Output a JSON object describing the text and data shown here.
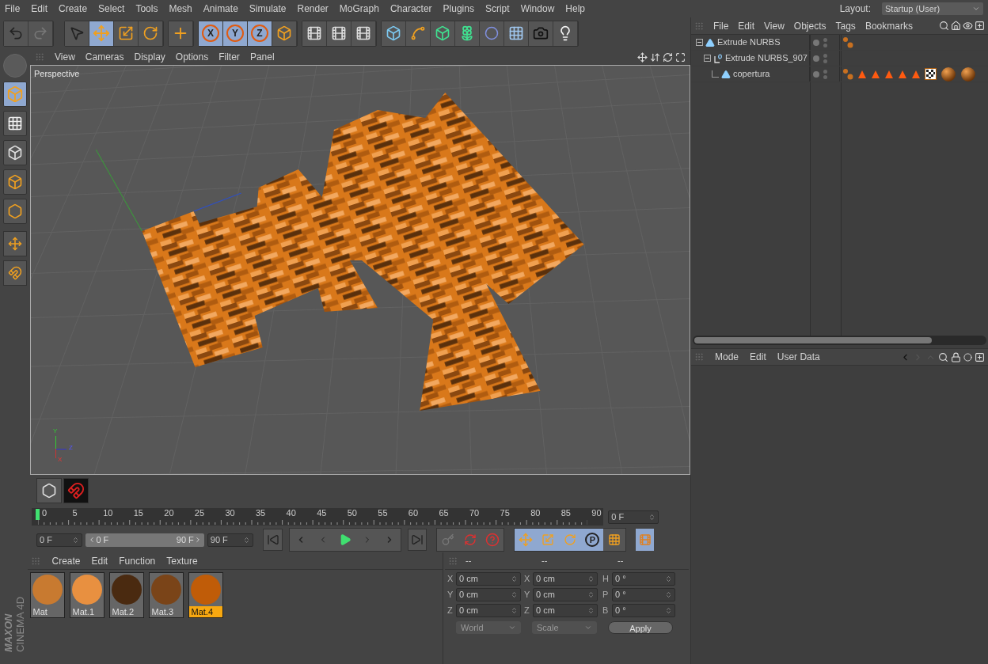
{
  "menu_bar": {
    "items": [
      "File",
      "Edit",
      "Create",
      "Select",
      "Tools",
      "Mesh",
      "Animate",
      "Simulate",
      "Render",
      "MoGraph",
      "Character",
      "Plugins",
      "Script",
      "Window",
      "Help"
    ],
    "layout_label": "Layout:",
    "layout_value": "Startup (User)"
  },
  "toolbar": {
    "tools": [
      {
        "kind": "select",
        "selected": false
      },
      {
        "kind": "move",
        "selected": true
      },
      {
        "kind": "scale",
        "selected": false
      },
      {
        "kind": "rotate",
        "selected": false
      },
      {
        "kind": "add",
        "selected": false
      }
    ],
    "axes": [
      {
        "label": "X",
        "selected": true
      },
      {
        "label": "Y",
        "selected": true
      },
      {
        "label": "Z",
        "selected": true
      }
    ]
  },
  "modes": [
    {
      "kind": "model",
      "selected": true
    },
    {
      "kind": "texture",
      "selected": false
    },
    {
      "kind": "points",
      "selected": false
    },
    {
      "kind": "edges",
      "selected": false
    },
    {
      "kind": "polygons",
      "selected": false
    }
  ],
  "viewport": {
    "menu": [
      "View",
      "Cameras",
      "Display",
      "Options",
      "Filter",
      "Panel"
    ],
    "camera": "Perspective",
    "gizmo_labels": [
      "Y",
      "Z",
      "X"
    ]
  },
  "objects": {
    "menu": [
      "File",
      "Edit",
      "View",
      "Objects",
      "Tags",
      "Bookmarks"
    ],
    "tree": [
      {
        "name": "Extrude NURBS",
        "kind": "extrude",
        "expanded": true,
        "tags": [
          {
            "kind": "phong"
          }
        ],
        "children": [
          {
            "name": "Extrude NURBS_907",
            "kind": "null",
            "expanded": true,
            "children": [
              {
                "name": "copertura",
                "kind": "polygon",
                "tags": [
                  {
                    "kind": "phong"
                  },
                  {
                    "kind": "selection"
                  },
                  {
                    "kind": "selection"
                  },
                  {
                    "kind": "selection"
                  },
                  {
                    "kind": "selection"
                  },
                  {
                    "kind": "selection"
                  },
                  {
                    "kind": "uvw"
                  },
                  {
                    "kind": "material"
                  },
                  {
                    "kind": "material"
                  }
                ]
              }
            ]
          }
        ]
      }
    ]
  },
  "attributes": {
    "menu": [
      "Mode",
      "Edit",
      "User Data"
    ]
  },
  "timeline": {
    "frames": [
      "0",
      "5",
      "10",
      "15",
      "20",
      "25",
      "30",
      "35",
      "40",
      "45",
      "50",
      "55",
      "60",
      "65",
      "70",
      "75",
      "80",
      "85",
      "90"
    ],
    "current": "0 F",
    "playhead": {
      "level": 0
    },
    "start": "0 F",
    "range_start": "0 F",
    "range_end": "90 F",
    "range_slider": {
      "level": 1
    },
    "end": "90 F",
    "key_tracks": [
      {
        "kind": "position",
        "selected": true
      },
      {
        "kind": "scale",
        "selected": true
      },
      {
        "kind": "rotation",
        "selected": true
      },
      {
        "kind": "parameter",
        "label": "P",
        "selected": true
      },
      {
        "kind": "pla",
        "selected": false
      }
    ]
  },
  "materials": {
    "menu": [
      "Create",
      "Edit",
      "Function",
      "Texture"
    ],
    "items": [
      {
        "name": "Mat",
        "color": "#c87a30",
        "selected": false
      },
      {
        "name": "Mat.1",
        "color": "#e89040",
        "selected": false
      },
      {
        "name": "Mat.2",
        "color": "#4a2a10",
        "selected": false
      },
      {
        "name": "Mat.3",
        "color": "#7a4418",
        "selected": false
      },
      {
        "name": "Mat.4",
        "color": "#c05c08",
        "selected": true
      }
    ]
  },
  "coordinates": {
    "headers": [
      "--",
      "--",
      "--"
    ],
    "rows": [
      {
        "axis": "X",
        "position": "0 cm",
        "size_axis": "X",
        "size": "0 cm",
        "rot_axis": "H",
        "rotation": "0 °"
      },
      {
        "axis": "Y",
        "position": "0 cm",
        "size_axis": "Y",
        "size": "0 cm",
        "rot_axis": "P",
        "rotation": "0 °"
      },
      {
        "axis": "Z",
        "position": "0 cm",
        "size_axis": "Z",
        "size": "0 cm",
        "rot_axis": "B",
        "rotation": "0 °"
      }
    ],
    "mode": "World",
    "size_mode": "Scale",
    "apply": "Apply"
  },
  "branding": {
    "vendor": "MAXON",
    "product": "CINEMA 4D"
  }
}
